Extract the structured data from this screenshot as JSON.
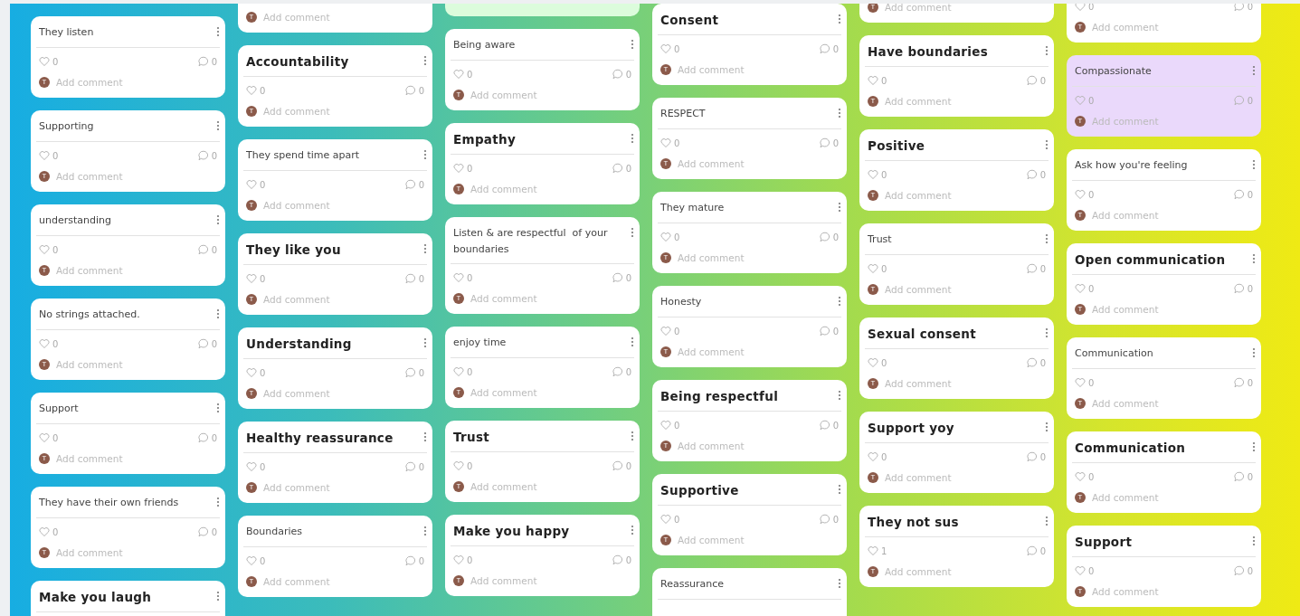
{
  "columns": [
    {
      "cards": [
        {
          "kind": "plain",
          "title": "They listen",
          "likes": "0",
          "comments": "0",
          "avatar": "T",
          "placeholder": "Add comment",
          "color": "#ffffff"
        },
        {
          "kind": "plain",
          "title": "Supporting",
          "likes": "0",
          "comments": "0",
          "avatar": "T",
          "placeholder": "Add comment",
          "color": "#ffffff"
        },
        {
          "kind": "plain",
          "title": "understanding",
          "likes": "0",
          "comments": "0",
          "avatar": "T",
          "placeholder": "Add comment",
          "color": "#ffffff"
        },
        {
          "kind": "plain",
          "title": "No strings attached.",
          "likes": "0",
          "comments": "0",
          "avatar": "T",
          "placeholder": "Add comment",
          "color": "#ffffff"
        },
        {
          "kind": "plain",
          "title": "Support",
          "likes": "0",
          "comments": "0",
          "avatar": "T",
          "placeholder": "Add comment",
          "color": "#ffffff"
        },
        {
          "kind": "plain",
          "title": "They have their own friends",
          "likes": "0",
          "comments": "0",
          "avatar": "T",
          "placeholder": "Add comment",
          "color": "#ffffff"
        },
        {
          "kind": "heading",
          "title": "Make you laugh",
          "color": "#ffffff"
        }
      ]
    },
    {
      "cards": [
        {
          "kind": "plain",
          "avatar": "T",
          "placeholder": "Add comment",
          "color": "#ffffff"
        },
        {
          "kind": "heading",
          "title": "Accountability",
          "likes": "0",
          "comments": "0",
          "avatar": "T",
          "placeholder": "Add comment",
          "color": "#ffffff"
        },
        {
          "kind": "plain",
          "title": "They spend time apart",
          "likes": "0",
          "comments": "0",
          "avatar": "T",
          "placeholder": "Add comment",
          "color": "#ffffff"
        },
        {
          "kind": "heading",
          "title": "They like you",
          "likes": "0",
          "comments": "0",
          "avatar": "T",
          "placeholder": "Add comment",
          "color": "#ffffff"
        },
        {
          "kind": "heading",
          "title": "Understanding",
          "likes": "0",
          "comments": "0",
          "avatar": "T",
          "placeholder": "Add comment",
          "color": "#ffffff"
        },
        {
          "kind": "heading",
          "title": "Healthy reassurance",
          "likes": "0",
          "comments": "0",
          "avatar": "T",
          "placeholder": "Add comment",
          "color": "#ffffff"
        },
        {
          "kind": "plain",
          "title": "Boundaries",
          "likes": "0",
          "comments": "0",
          "avatar": "T",
          "placeholder": "Add comment",
          "color": "#ffffff"
        }
      ]
    },
    {
      "cards": [
        {
          "kind": "plain",
          "color": "#dcfcdc"
        },
        {
          "kind": "plain",
          "title": "Being aware",
          "likes": "0",
          "comments": "0",
          "avatar": "T",
          "placeholder": "Add comment",
          "color": "#ffffff"
        },
        {
          "kind": "heading",
          "title": "Empathy",
          "likes": "0",
          "comments": "0",
          "avatar": "T",
          "placeholder": "Add comment",
          "color": "#ffffff"
        },
        {
          "kind": "plain",
          "title": "Listen & are respectful  of your boundaries",
          "likes": "0",
          "comments": "0",
          "avatar": "T",
          "placeholder": "Add comment",
          "color": "#ffffff"
        },
        {
          "kind": "plain",
          "title": "enjoy time",
          "likes": "0",
          "comments": "0",
          "avatar": "T",
          "placeholder": "Add comment",
          "color": "#ffffff"
        },
        {
          "kind": "heading",
          "title": "Trust",
          "likes": "0",
          "comments": "0",
          "avatar": "T",
          "placeholder": "Add comment",
          "color": "#ffffff"
        },
        {
          "kind": "heading",
          "title": "Make you happy",
          "likes": "0",
          "comments": "0",
          "avatar": "T",
          "placeholder": "Add comment",
          "color": "#ffffff"
        }
      ]
    },
    {
      "cards": [
        {
          "kind": "heading",
          "title": "Consent",
          "likes": "0",
          "comments": "0",
          "avatar": "T",
          "placeholder": "Add comment",
          "color": "#ffffff"
        },
        {
          "kind": "plain",
          "title": "RESPECT",
          "likes": "0",
          "comments": "0",
          "avatar": "T",
          "placeholder": "Add comment",
          "color": "#ffffff"
        },
        {
          "kind": "plain",
          "title": "They mature",
          "likes": "0",
          "comments": "0",
          "avatar": "T",
          "placeholder": "Add comment",
          "color": "#ffffff"
        },
        {
          "kind": "plain",
          "title": "Honesty",
          "likes": "0",
          "comments": "0",
          "avatar": "T",
          "placeholder": "Add comment",
          "color": "#ffffff"
        },
        {
          "kind": "heading",
          "title": "Being respectful",
          "likes": "0",
          "comments": "0",
          "avatar": "T",
          "placeholder": "Add comment",
          "color": "#ffffff"
        },
        {
          "kind": "heading",
          "title": "Supportive",
          "likes": "0",
          "comments": "0",
          "avatar": "T",
          "placeholder": "Add comment",
          "color": "#ffffff"
        },
        {
          "kind": "plain",
          "title": "Reassurance",
          "color": "#ffffff"
        }
      ]
    },
    {
      "cards": [
        {
          "kind": "plain",
          "avatar": "T",
          "placeholder": "Add comment",
          "color": "#ffffff"
        },
        {
          "kind": "heading",
          "title": "Have boundaries",
          "likes": "0",
          "comments": "0",
          "avatar": "T",
          "placeholder": "Add comment",
          "color": "#ffffff"
        },
        {
          "kind": "heading",
          "title": "Positive",
          "likes": "0",
          "comments": "0",
          "avatar": "T",
          "placeholder": "Add comment",
          "color": "#ffffff"
        },
        {
          "kind": "plain",
          "title": "Trust",
          "likes": "0",
          "comments": "0",
          "avatar": "T",
          "placeholder": "Add comment",
          "color": "#ffffff"
        },
        {
          "kind": "heading",
          "title": "Sexual consent",
          "likes": "0",
          "comments": "0",
          "avatar": "T",
          "placeholder": "Add comment",
          "color": "#ffffff"
        },
        {
          "kind": "heading",
          "title": "Support yoy",
          "likes": "0",
          "comments": "0",
          "avatar": "T",
          "placeholder": "Add comment",
          "color": "#ffffff"
        },
        {
          "kind": "heading",
          "title": "They not sus",
          "likes": "1",
          "comments": "0",
          "avatar": "T",
          "placeholder": "Add comment",
          "color": "#ffffff"
        }
      ]
    },
    {
      "cards": [
        {
          "kind": "plain",
          "likes": "0",
          "comments": "0",
          "avatar": "T",
          "placeholder": "Add comment",
          "color": "#ffffff"
        },
        {
          "kind": "plain",
          "title": "Compassionate",
          "likes": "0",
          "comments": "0",
          "avatar": "T",
          "placeholder": "Add comment",
          "color": "#ead9fb"
        },
        {
          "kind": "plain",
          "title": "Ask how you're feeling",
          "likes": "0",
          "comments": "0",
          "avatar": "T",
          "placeholder": "Add comment",
          "color": "#ffffff"
        },
        {
          "kind": "heading",
          "title": "Open communication",
          "likes": "0",
          "comments": "0",
          "avatar": "T",
          "placeholder": "Add comment",
          "color": "#ffffff"
        },
        {
          "kind": "plain",
          "title": "Communication",
          "likes": "0",
          "comments": "0",
          "avatar": "T",
          "placeholder": "Add comment",
          "color": "#ffffff"
        },
        {
          "kind": "heading",
          "title": "Communication",
          "likes": "0",
          "comments": "0",
          "avatar": "T",
          "placeholder": "Add comment",
          "color": "#ffffff"
        },
        {
          "kind": "heading",
          "title": "Support",
          "likes": "0",
          "comments": "0",
          "avatar": "T",
          "placeholder": "Add comment",
          "color": "#ffffff"
        }
      ]
    }
  ]
}
